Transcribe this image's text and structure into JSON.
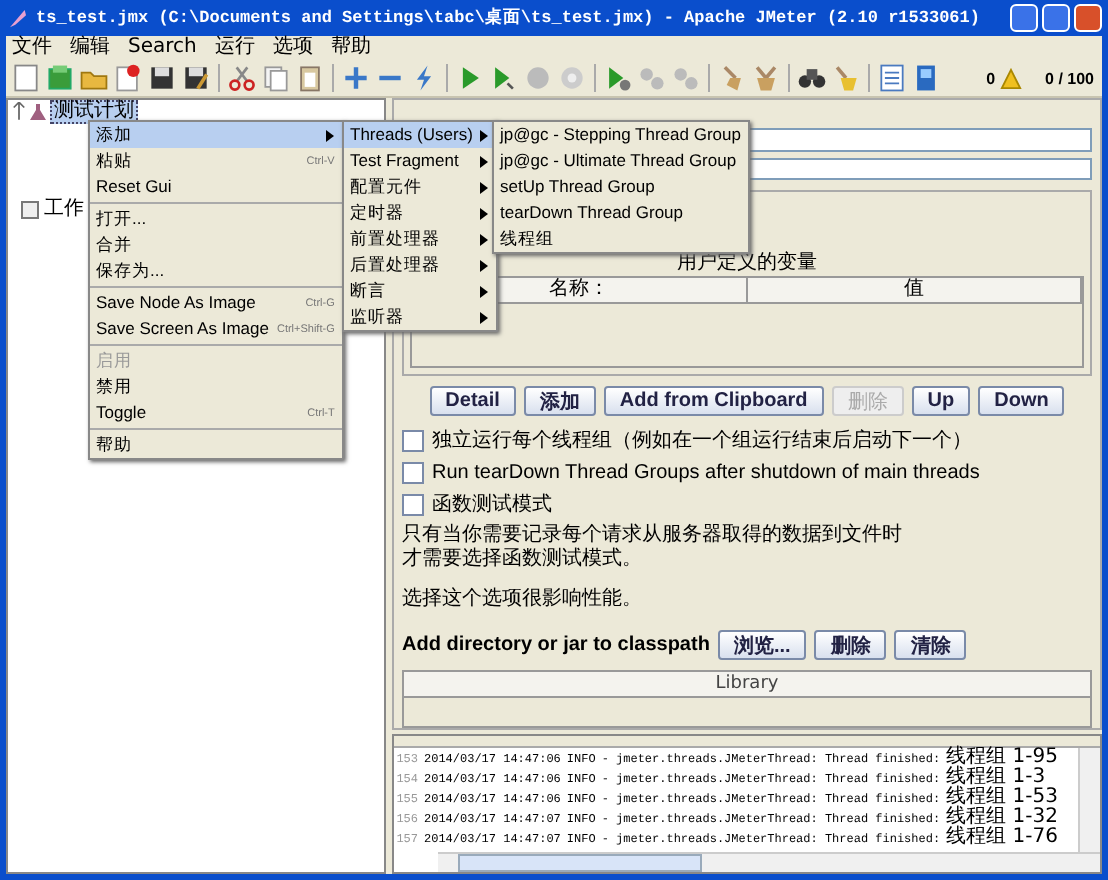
{
  "window": {
    "title": "ts_test.jmx (C:\\Documents and Settings\\tabc\\桌面\\ts_test.jmx) - Apache JMeter (2.10 r1533061)"
  },
  "menu_bar": [
    "文件",
    "编辑",
    "Search",
    "运行",
    "选项",
    "帮助"
  ],
  "toolbar": {
    "warning_count": "0",
    "threads": "0 / 100"
  },
  "tree": [
    {
      "label": "测试计划",
      "selected": true
    },
    {
      "label": "工作",
      "selected": false
    }
  ],
  "context_menu": {
    "groups": [
      [
        {
          "label": "添加",
          "has_submenu": true,
          "selected": true,
          "disabled": false
        },
        {
          "label": "粘贴",
          "shortcut": "Ctrl-V",
          "has_submenu": false,
          "selected": false,
          "disabled": false
        },
        {
          "label": "Reset Gui",
          "has_submenu": false,
          "selected": false,
          "disabled": false
        }
      ],
      [
        {
          "label": "打开...",
          "has_submenu": false,
          "selected": false,
          "disabled": false
        },
        {
          "label": "合并",
          "has_submenu": false,
          "selected": false,
          "disabled": false
        },
        {
          "label": "保存为...",
          "has_submenu": false,
          "selected": false,
          "disabled": false
        }
      ],
      [
        {
          "label": "Save Node As Image",
          "shortcut": "Ctrl-G",
          "has_submenu": false,
          "selected": false,
          "disabled": false
        },
        {
          "label": "Save Screen As Image",
          "shortcut": "Ctrl+Shift-G",
          "has_submenu": false,
          "selected": false,
          "disabled": false
        }
      ],
      [
        {
          "label": "启用",
          "has_submenu": false,
          "selected": false,
          "disabled": true
        },
        {
          "label": "禁用",
          "has_submenu": false,
          "selected": false,
          "disabled": false
        },
        {
          "label": "Toggle",
          "shortcut": "Ctrl-T",
          "has_submenu": false,
          "selected": false,
          "disabled": false
        }
      ],
      [
        {
          "label": "帮助",
          "has_submenu": false,
          "selected": false,
          "disabled": false
        }
      ]
    ]
  },
  "submenu": [
    {
      "label": "Threads (Users)",
      "selected": true
    },
    {
      "label": "Test Fragment",
      "selected": false
    },
    {
      "label": "配置元件",
      "selected": false
    },
    {
      "label": "定时器",
      "selected": false
    },
    {
      "label": "前置处理器",
      "selected": false
    },
    {
      "label": "后置处理器",
      "selected": false
    },
    {
      "label": "断言",
      "selected": false
    },
    {
      "label": "监听器",
      "selected": false
    }
  ],
  "threads_submenu": [
    {
      "label": "jp@gc - Stepping Thread Group",
      "selected": false
    },
    {
      "label": "jp@gc - Ultimate Thread Group",
      "selected": false
    },
    {
      "label": "setUp Thread Group",
      "selected": false
    },
    {
      "label": "tearDown Thread Group",
      "selected": false
    },
    {
      "label": "线程组",
      "selected": false
    }
  ],
  "variables": {
    "title": "用户定义的变量",
    "columns": [
      "名称：",
      "值"
    ]
  },
  "variable_buttons": [
    {
      "label": "Detail",
      "disabled": false
    },
    {
      "label": "添加",
      "disabled": false
    },
    {
      "label": "Add from Clipboard",
      "disabled": false
    },
    {
      "label": "删除",
      "disabled": true
    },
    {
      "label": "Up",
      "disabled": false
    },
    {
      "label": "Down",
      "disabled": false
    }
  ],
  "options": [
    {
      "label": "独立运行每个线程组（例如在一个组运行结束后启动下一个）",
      "checked": false
    },
    {
      "label": "Run tearDown Thread Groups after shutdown of main threads",
      "checked": false
    },
    {
      "label": "函数测试模式",
      "checked": false
    }
  ],
  "notes": [
    "只有当你需要记录每个请求从服务器取得的数据到文件时",
    "才需要选择函数测试模式。",
    "选择这个选项很影响性能。"
  ],
  "classpath": {
    "label": "Add directory or jar to classpath",
    "buttons": [
      "浏览...",
      "删除",
      "清除"
    ],
    "column": "Library"
  },
  "log": [
    {
      "line": "153",
      "time": "2014/03/17 14:47:06",
      "level": "INFO",
      "source": "- jmeter.threads.JMeterThread: Thread finished:",
      "thread": "线程组 1-95"
    },
    {
      "line": "154",
      "time": "2014/03/17 14:47:06",
      "level": "INFO",
      "source": "- jmeter.threads.JMeterThread: Thread finished:",
      "thread": "线程组 1-3"
    },
    {
      "line": "155",
      "time": "2014/03/17 14:47:06",
      "level": "INFO",
      "source": "- jmeter.threads.JMeterThread: Thread finished:",
      "thread": "线程组 1-53"
    },
    {
      "line": "156",
      "time": "2014/03/17 14:47:07",
      "level": "INFO",
      "source": "- jmeter.threads.JMeterThread: Thread finished:",
      "thread": "线程组 1-32"
    },
    {
      "line": "157",
      "time": "2014/03/17 14:47:07",
      "level": "INFO",
      "source": "- jmeter.threads.JMeterThread: Thread finished:",
      "thread": "线程组 1-76"
    }
  ]
}
